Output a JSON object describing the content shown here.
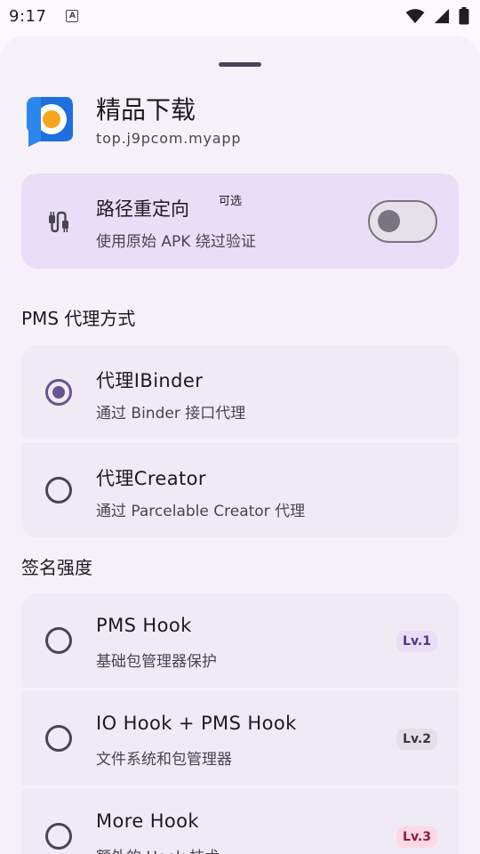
{
  "status_bar": {
    "time": "9:17",
    "notification_icon": "A"
  },
  "app": {
    "name": "精品下载",
    "package": "top.j9pcom.myapp",
    "icon": "app-logo-icon"
  },
  "redirect": {
    "title": "路径重定向",
    "badge": "可选",
    "subtitle": "使用原始 APK 绕过验证",
    "enabled": false
  },
  "pms_section": {
    "title": "PMS 代理方式",
    "options": [
      {
        "title": "代理IBinder",
        "subtitle": "通过 Binder 接口代理",
        "selected": true
      },
      {
        "title": "代理Creator",
        "subtitle": "通过 Parcelable Creator 代理",
        "selected": false
      }
    ]
  },
  "signature_section": {
    "title": "签名强度",
    "options": [
      {
        "title": "PMS Hook",
        "subtitle": "基础包管理器保护",
        "level": "Lv.1",
        "selected": false
      },
      {
        "title": "IO Hook + PMS Hook",
        "subtitle": "文件系统和包管理器",
        "level": "Lv.2",
        "selected": false
      },
      {
        "title": "More Hook",
        "subtitle": "额外的 Hook 技术",
        "level": "Lv.3",
        "selected": false
      }
    ]
  },
  "colors": {
    "accent": "#65558f",
    "lv1_bg": "#e8def8",
    "lv1_fg": "#4f378a",
    "lv2_bg": "#e3dfe6",
    "lv2_fg": "#3b3643",
    "lv3_bg": "#ffd8e4",
    "lv3_fg": "#8c1d3e"
  }
}
